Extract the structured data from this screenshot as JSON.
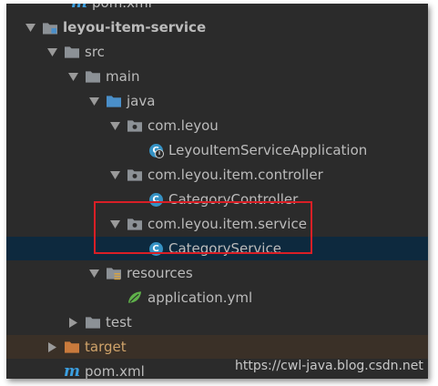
{
  "tree": {
    "top_clipped": "pom.xml",
    "module": "leyou-item-service",
    "src": "src",
    "main": "main",
    "java": "java",
    "pkg_root": "com.leyou",
    "app_class": "LeyouItemServiceApplication",
    "pkg_controller": "com.leyou.item.controller",
    "controller_class": "CategoryController",
    "pkg_service": "com.leyou.item.service",
    "service_class": "CategoryService",
    "resources": "resources",
    "app_yml": "application.yml",
    "test": "test",
    "target": "target",
    "pom": "pom.xml"
  },
  "class_badge_letter": "C",
  "maven_letter": "m",
  "watermark": "https://cwl-java.blog.csdn.net",
  "colors": {
    "background": "#2b2b2b",
    "selection": "#0d293e",
    "excluded_row": "#3a3027",
    "highlight_box": "#d91f26",
    "folder_grey": "#8c9196",
    "folder_source_blue": "#4a8fc9",
    "folder_target_orange": "#c97a3c",
    "class_badge": "#3592c4"
  }
}
